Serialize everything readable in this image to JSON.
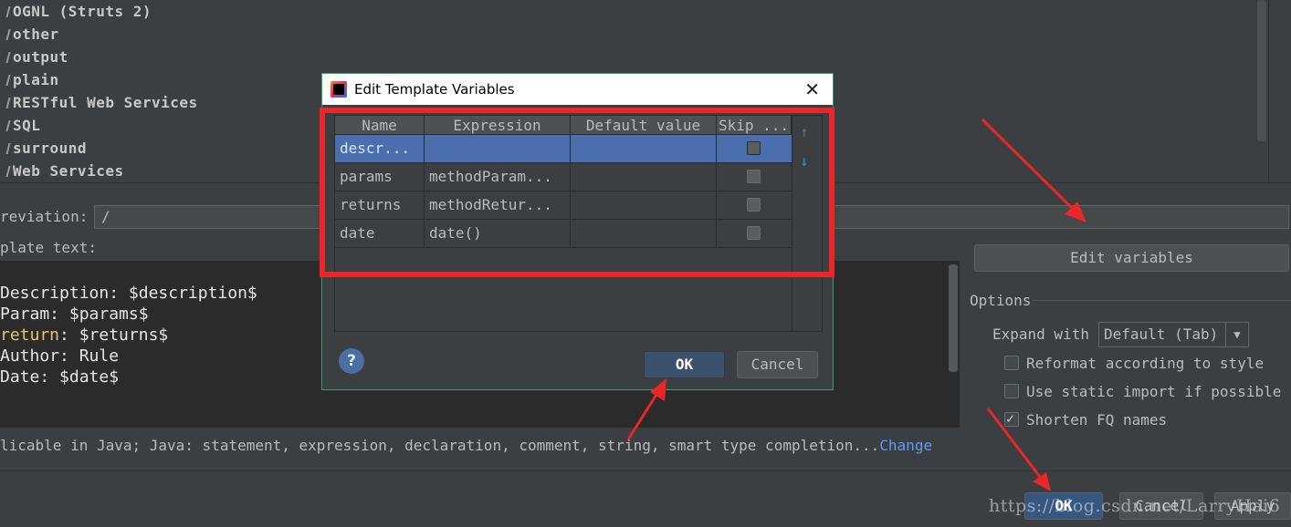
{
  "groups": [
    "OGNL (Struts 2)",
    "other",
    "output",
    "plain",
    "RESTful Web Services",
    "SQL",
    "surround",
    "Web Services"
  ],
  "abbreviation": {
    "label": "reviation:",
    "value": "/"
  },
  "template_text": {
    "label": "plate text:",
    "lines": [
      {
        "key": "Description: ",
        "value": "$description$"
      },
      {
        "key": "Param: ",
        "value": "$params$"
      },
      {
        "key": "return",
        "value": ": $returns$"
      },
      {
        "key": "Author: ",
        "value": "Rule"
      },
      {
        "key": "Date: ",
        "value": "$date$"
      }
    ]
  },
  "applicable": {
    "text": "licable in Java; Java: statement, expression, declaration, comment, string, smart type completion...",
    "link": "Change"
  },
  "right_panel": {
    "edit_variables_button": "Edit variables",
    "options_title": "Options",
    "expand_label": "Expand with",
    "expand_value": "Default (Tab)",
    "options": [
      {
        "label": "Reformat according to style",
        "checked": false
      },
      {
        "label": "Use static import if possible",
        "checked": false
      },
      {
        "label": "Shorten FQ names",
        "checked": true
      }
    ]
  },
  "footer": {
    "ok": "OK",
    "cancel": "Cancel",
    "apply": "Apply"
  },
  "watermark": "https://blog.csdn.net/LarryHai6",
  "dialog": {
    "title": "Edit Template Variables",
    "close": "✕",
    "columns": [
      "Name",
      "Expression",
      "Default value",
      "Skip ..."
    ],
    "rows": [
      {
        "name": "descr...",
        "expression": "",
        "default": "",
        "skip": false,
        "selected": true
      },
      {
        "name": "params",
        "expression": "methodParam...",
        "default": "",
        "skip": false,
        "selected": false
      },
      {
        "name": "returns",
        "expression": "methodRetur...",
        "default": "",
        "skip": false,
        "selected": false
      },
      {
        "name": "date",
        "expression": "date()",
        "default": "",
        "skip": false,
        "selected": false
      }
    ],
    "help": "?",
    "ok": "OK",
    "cancel": "Cancel",
    "move_up_icon": "↑",
    "move_down_icon": "↓"
  },
  "colors": {
    "annotation_red": "#e9262a",
    "selection": "#4b6eaf",
    "link": "#589df6"
  }
}
